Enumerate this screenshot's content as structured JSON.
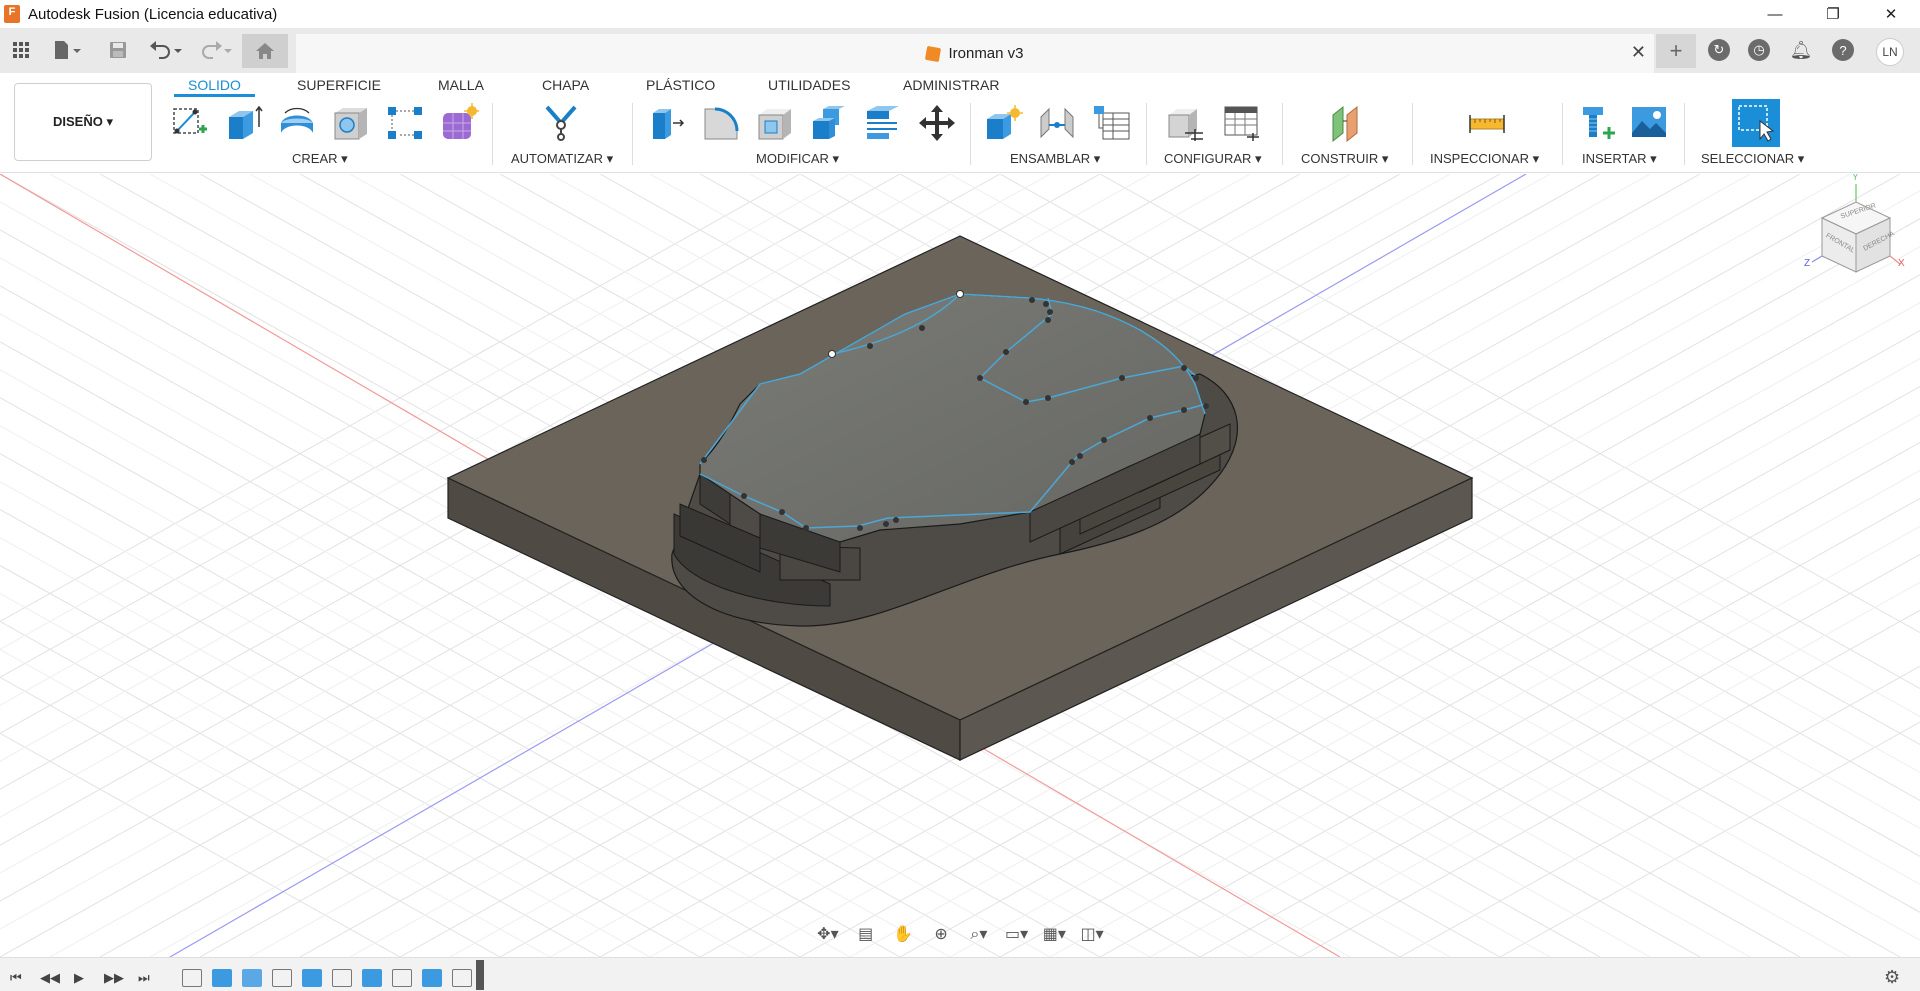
{
  "titlebar": {
    "title": "Autodesk Fusion (Licencia educativa)",
    "logo_letter": "F",
    "minimize": "—",
    "restore": "❐",
    "close": "✕"
  },
  "tabbar": {
    "document_name": "Ironman v3",
    "close_glyph": "✕",
    "add_glyph": "+",
    "user_initials": "LN"
  },
  "toolbar": {
    "workspace_label": "DISEÑO ▾",
    "tabs": [
      {
        "label": "SOLIDO",
        "active": true
      },
      {
        "label": "SUPERFICIE",
        "active": false
      },
      {
        "label": "MALLA",
        "active": false
      },
      {
        "label": "CHAPA",
        "active": false
      },
      {
        "label": "PLÁSTICO",
        "active": false
      },
      {
        "label": "UTILIDADES",
        "active": false
      },
      {
        "label": "ADMINISTRAR",
        "active": false
      }
    ],
    "groups": [
      {
        "label": "CREAR ▾"
      },
      {
        "label": "AUTOMATIZAR ▾"
      },
      {
        "label": "MODIFICAR ▾"
      },
      {
        "label": "ENSAMBLAR ▾"
      },
      {
        "label": "CONFIGURAR ▾"
      },
      {
        "label": "CONSTRUIR ▾"
      },
      {
        "label": "INSPECCIONAR ▾"
      },
      {
        "label": "INSERTAR ▾"
      },
      {
        "label": "SELECCIONAR ▾"
      }
    ]
  },
  "viewcube": {
    "top": "SUPERIOR",
    "front": "FRONTAL",
    "right": "DERECHA",
    "axis_x": "X",
    "axis_y": "Y",
    "axis_z": "Z"
  },
  "colors": {
    "accent": "#1a8ed6",
    "model_dark": "#5a5650",
    "model_top": "#6e6f69",
    "grid": "#d9d9d9",
    "axis_red": "#f08a8a",
    "axis_blue": "#8a8af0",
    "sketch_line": "#4aa8d8"
  }
}
